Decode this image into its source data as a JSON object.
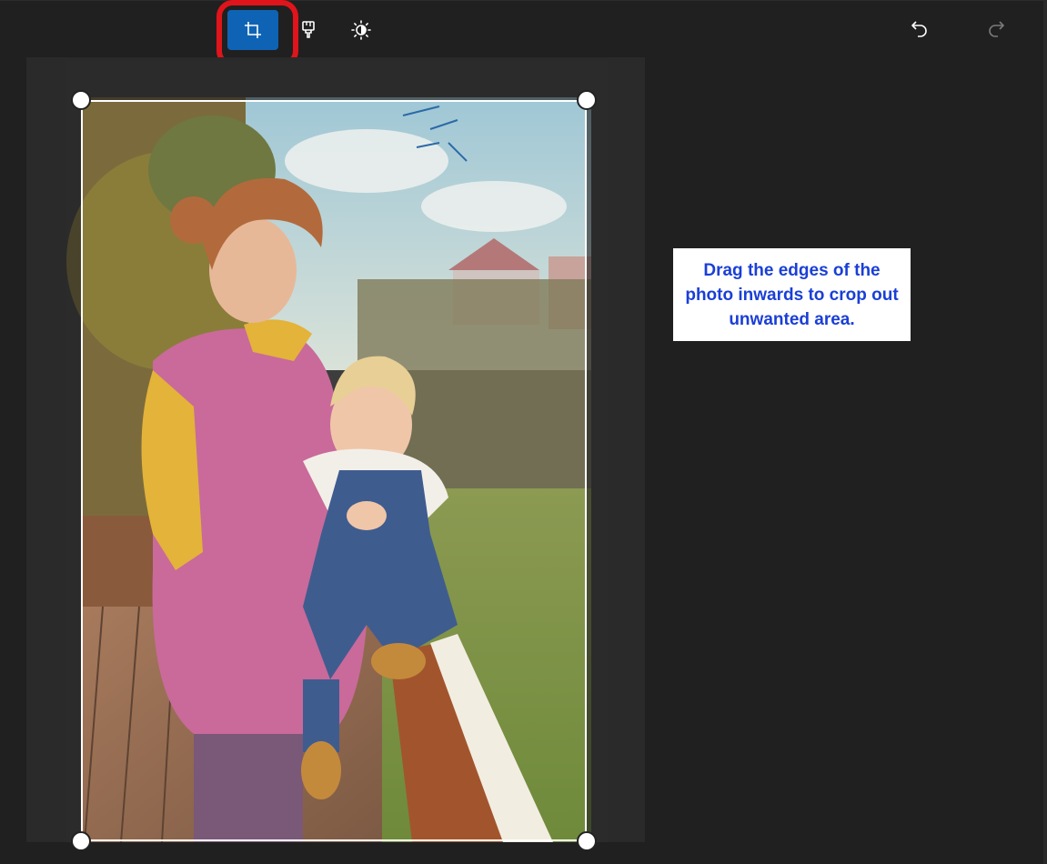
{
  "toolbar": {
    "tools": [
      {
        "name": "crop",
        "icon": "crop-icon",
        "active": true
      },
      {
        "name": "filters",
        "icon": "brush-icon",
        "active": false
      },
      {
        "name": "adjustments",
        "icon": "brightness-icon",
        "active": false
      }
    ],
    "undo_icon": "undo-icon",
    "redo_icon": "redo-icon",
    "redo_enabled": false
  },
  "tip": {
    "text": "Drag the edges of the photo inwards to crop out unwanted area."
  },
  "colors": {
    "accent": "#0f63b5",
    "highlight": "#e0141b",
    "tip_text": "#1a3fd6",
    "background": "#202020"
  }
}
